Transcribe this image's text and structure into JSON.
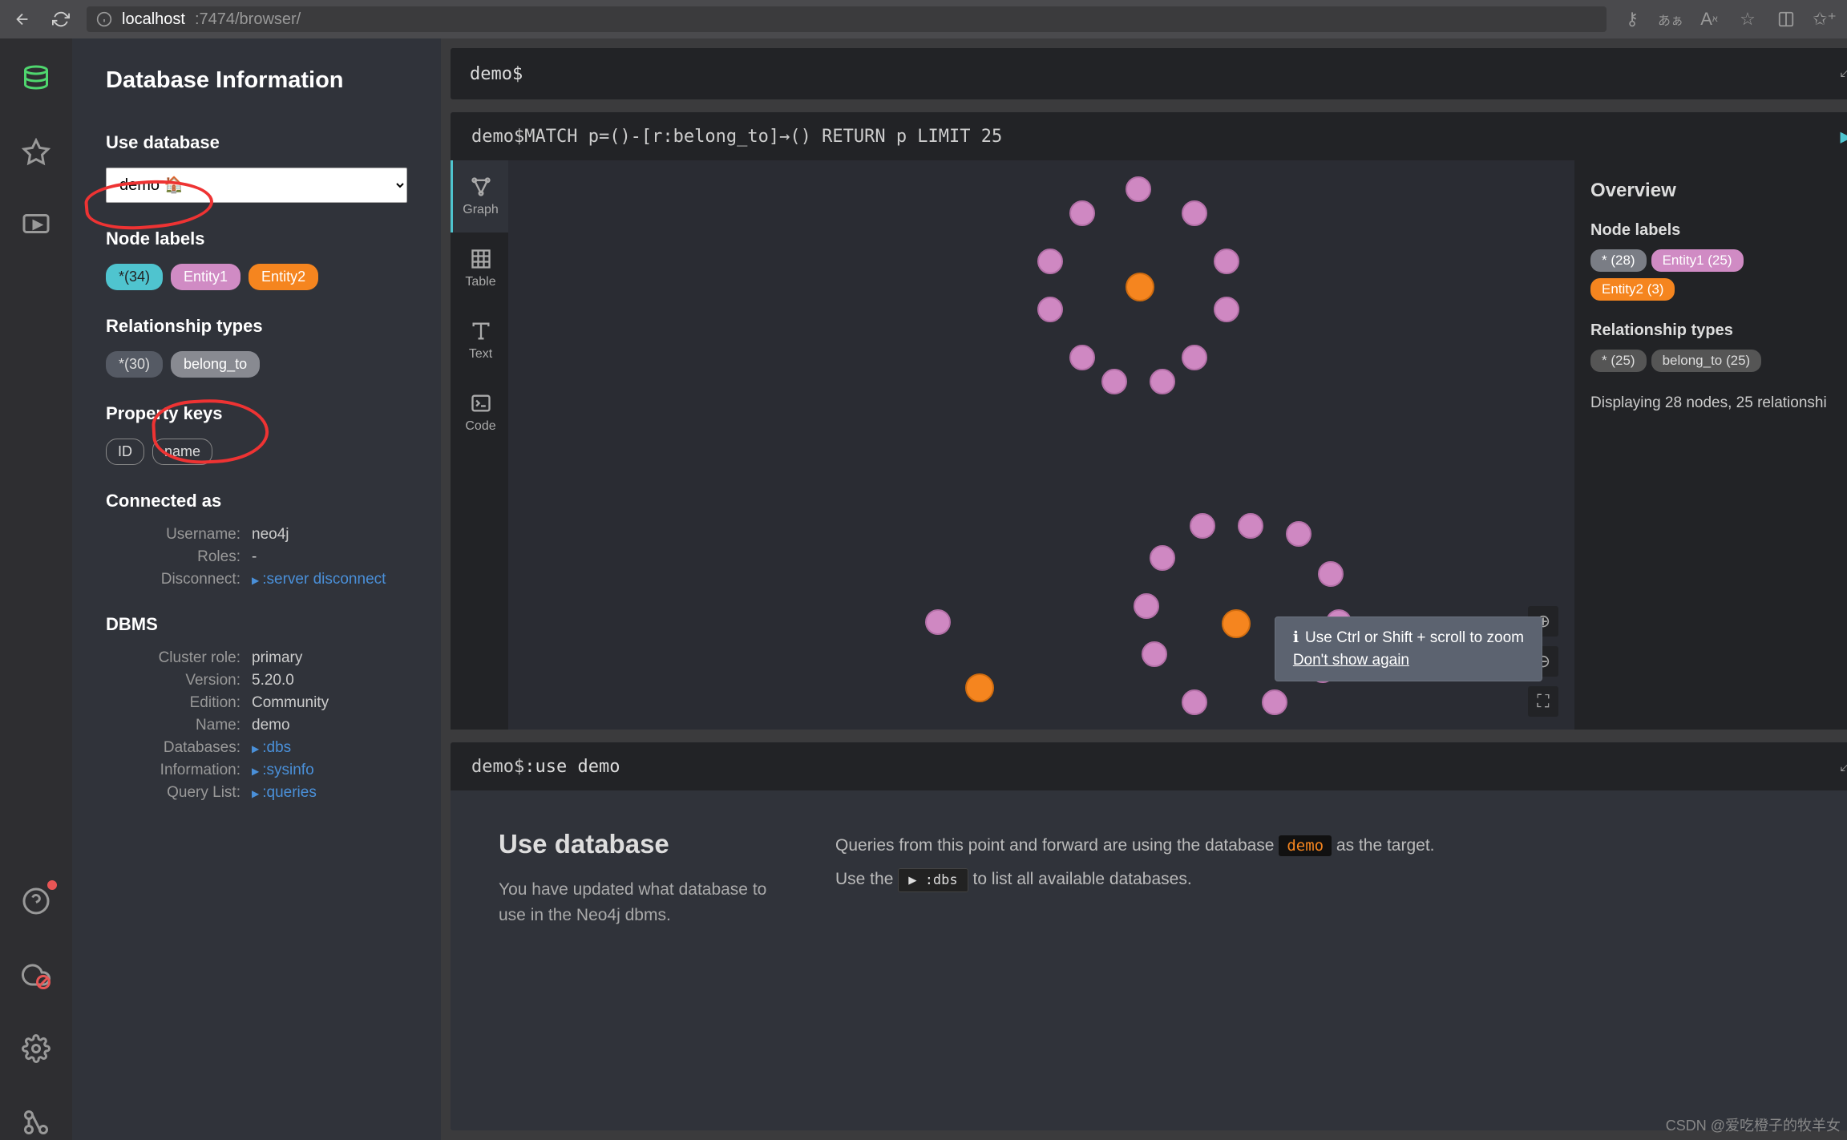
{
  "browser": {
    "url_host": "localhost",
    "url_port_path": ":7474/browser/"
  },
  "sidebar": {
    "title": "Database Information",
    "use_db_label": "Use database",
    "db_selected": "demo 🏠",
    "node_labels_heading": "Node labels",
    "node_labels": [
      {
        "text": "*(34)",
        "cls": "cyan"
      },
      {
        "text": "Entity1",
        "cls": "pink"
      },
      {
        "text": "Entity2",
        "cls": "orange"
      }
    ],
    "rel_types_heading": "Relationship types",
    "rel_types": [
      {
        "text": "*(30)",
        "cls": "block"
      },
      {
        "text": "belong_to",
        "cls": "grey2"
      }
    ],
    "prop_keys_heading": "Property keys",
    "prop_keys": [
      {
        "text": "ID"
      },
      {
        "text": "name"
      }
    ],
    "connected_as_heading": "Connected as",
    "username_label": "Username:",
    "username": "neo4j",
    "roles_label": "Roles:",
    "roles": "-",
    "disconnect_label": "Disconnect:",
    "disconnect_link": ":server disconnect",
    "dbms_heading": "DBMS",
    "dbms": [
      {
        "k": "Cluster role:",
        "v": "primary"
      },
      {
        "k": "Version:",
        "v": "5.20.0"
      },
      {
        "k": "Edition:",
        "v": "Community"
      },
      {
        "k": "Name:",
        "v": "demo"
      },
      {
        "k": "Databases:",
        "link": ":dbs"
      },
      {
        "k": "Information:",
        "link": ":sysinfo"
      },
      {
        "k": "Query List:",
        "link": ":queries"
      }
    ]
  },
  "editor": {
    "prompt": "demo$"
  },
  "frame1": {
    "prompt": "demo$ ",
    "query": "MATCH p=()-[r:belong_to]→() RETURN p LIMIT 25",
    "tabs": [
      "Graph",
      "Table",
      "Text",
      "Code"
    ],
    "overview": {
      "title": "Overview",
      "node_labels": "Node labels",
      "labels": [
        {
          "text": "* (28)",
          "cls": "grey"
        },
        {
          "text": "Entity1 (25)",
          "cls": "pink"
        },
        {
          "text": "Entity2 (3)",
          "cls": "orange"
        }
      ],
      "rel_types": "Relationship types",
      "rels": [
        {
          "text": "* (25)",
          "cls": "block"
        },
        {
          "text": "belong_to (25)",
          "cls": "block"
        }
      ],
      "status": "Displaying 28 nodes, 25 relationshi"
    },
    "tooltip": {
      "msg": "Use Ctrl or Shift + scroll to zoom",
      "dismiss": "Don't show again"
    }
  },
  "frame2": {
    "prompt": "demo$ ",
    "query": ":use demo",
    "title": "Use database",
    "desc": "You have updated what database to use in the Neo4j dbms.",
    "right1_a": "Queries from this point and forward are using the database ",
    "right1_chip": "demo",
    "right1_b": " as the target.",
    "right2_a": "Use the ",
    "right2_chip": "▶ :dbs",
    "right2_b": " to list all available databases."
  },
  "watermark": "CSDN @爱吃橙子的牧羊女"
}
